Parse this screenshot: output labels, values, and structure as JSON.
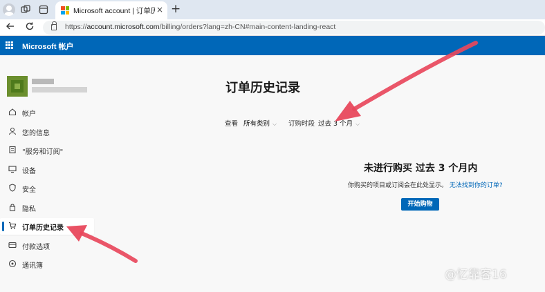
{
  "browser": {
    "tab_title": "Microsoft account | 订单历史记录",
    "tab_close": "×",
    "new_tab": "+",
    "url_prefix": "https://",
    "url_host": "account.microsoft.com",
    "url_path": "/billing/orders?lang=zh-CN#main-content-landing-react"
  },
  "header": {
    "title": "Microsoft 帐户"
  },
  "sidebar": {
    "items": [
      {
        "label": "帐户",
        "icon": "home-icon"
      },
      {
        "label": "您的信息",
        "icon": "person-icon"
      },
      {
        "label": "\"服务和订阅\"",
        "icon": "subscription-icon"
      },
      {
        "label": "设备",
        "icon": "monitor-icon"
      },
      {
        "label": "安全",
        "icon": "shield-icon"
      },
      {
        "label": "隐私",
        "icon": "lock-icon"
      },
      {
        "label": "订单历史记录",
        "icon": "cart-icon",
        "active": true
      },
      {
        "label": "付款选项",
        "icon": "card-icon"
      },
      {
        "label": "通讯簿",
        "icon": "location-icon"
      }
    ]
  },
  "main": {
    "title": "订单历史记录",
    "filter": {
      "view_label": "查看",
      "category_value": "所有类别",
      "period_label": "订购时段",
      "period_value": "过去 3 个月"
    },
    "empty": {
      "title": "未进行购买 过去 3 个月内",
      "desc": "你购买的项目或订阅会在此处显示。",
      "link": "无法找到你的订单?",
      "button": "开始购物"
    }
  },
  "watermark": "@忆靠客16",
  "colors": {
    "brand": "#0067b8",
    "arrow": "#e8485c"
  }
}
